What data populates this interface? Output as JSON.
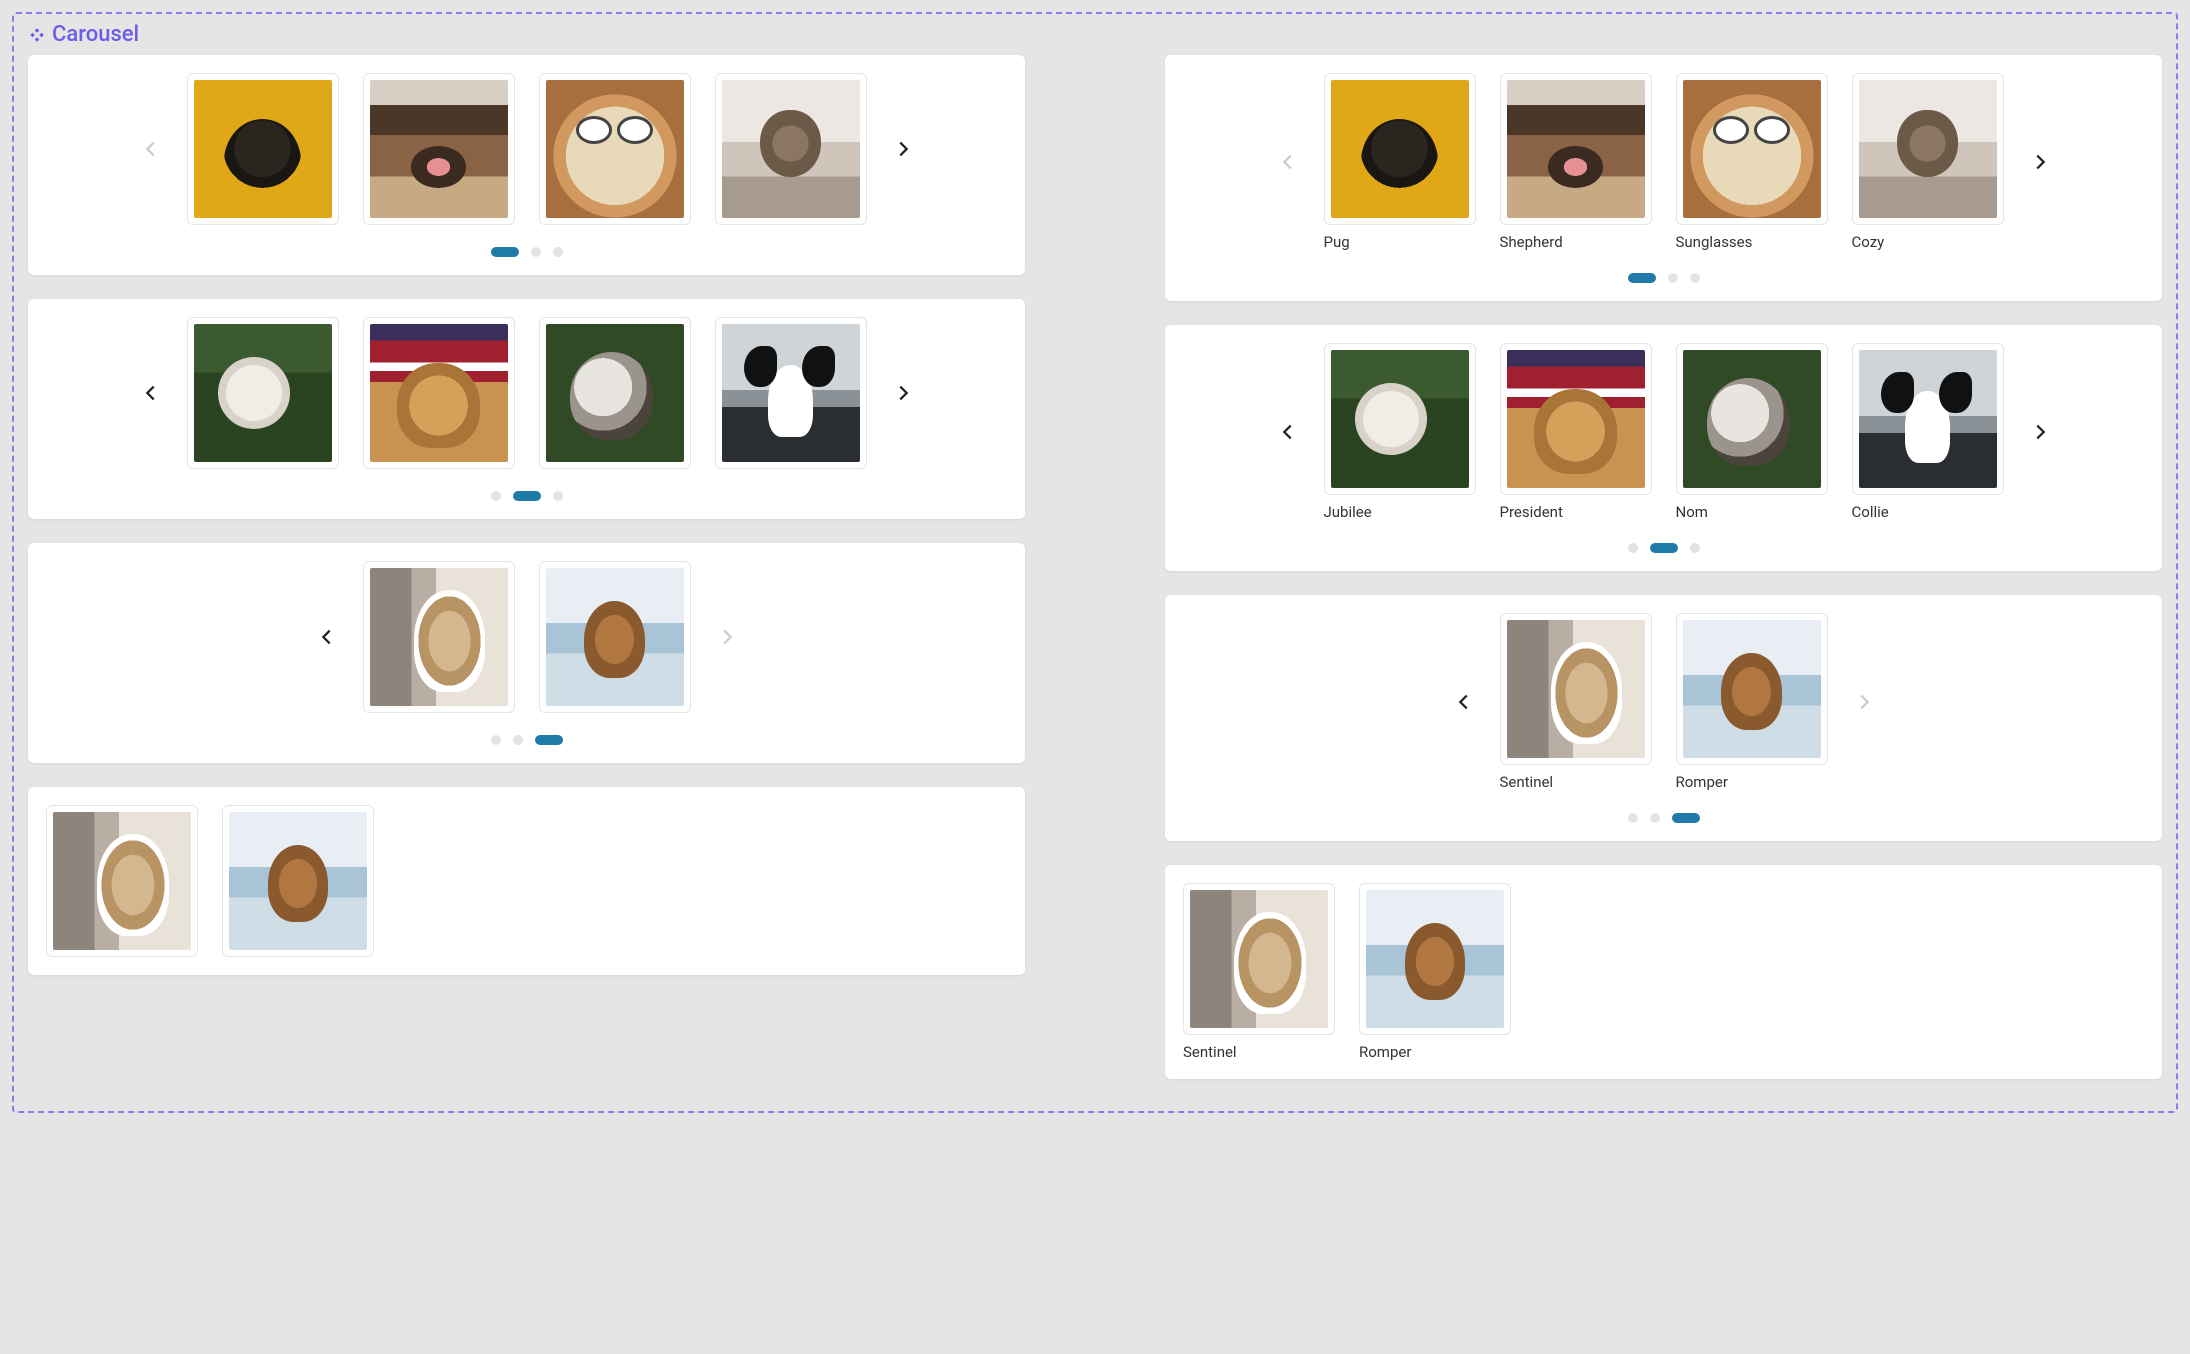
{
  "section": {
    "title": "Carousel"
  },
  "dogs": {
    "pug": "Pug",
    "shepherd": "Shepherd",
    "sunglasses": "Sunglasses",
    "cozy": "Cozy",
    "jubilee": "Jubilee",
    "president": "President",
    "nom": "Nom",
    "collie": "Collie",
    "sentinel": "Sentinel",
    "romper": "Romper"
  },
  "left_column": {
    "panels": [
      {
        "images": [
          "pug",
          "shepherd",
          "sunglasses",
          "cozy"
        ],
        "active_dot": 0,
        "dot_count": 3,
        "prev_enabled": false,
        "next_enabled": true,
        "captions": false
      },
      {
        "images": [
          "jubilee",
          "president",
          "nom",
          "collie"
        ],
        "active_dot": 1,
        "dot_count": 3,
        "prev_enabled": true,
        "next_enabled": true,
        "captions": false
      },
      {
        "images": [
          "sentinel",
          "romper"
        ],
        "active_dot": 2,
        "dot_count": 3,
        "prev_enabled": true,
        "next_enabled": false,
        "captions": false
      },
      {
        "images": [
          "sentinel",
          "romper"
        ],
        "no_arrows": true,
        "captions": false
      }
    ]
  },
  "right_column": {
    "panels": [
      {
        "images": [
          "pug",
          "shepherd",
          "sunglasses",
          "cozy"
        ],
        "active_dot": 0,
        "dot_count": 3,
        "prev_enabled": false,
        "next_enabled": true,
        "captions": true
      },
      {
        "images": [
          "jubilee",
          "president",
          "nom",
          "collie"
        ],
        "active_dot": 1,
        "dot_count": 3,
        "prev_enabled": true,
        "next_enabled": true,
        "captions": true
      },
      {
        "images": [
          "sentinel",
          "romper"
        ],
        "active_dot": 2,
        "dot_count": 3,
        "prev_enabled": true,
        "next_enabled": false,
        "captions": true
      },
      {
        "images": [
          "sentinel",
          "romper"
        ],
        "no_arrows": true,
        "captions": true
      }
    ]
  }
}
